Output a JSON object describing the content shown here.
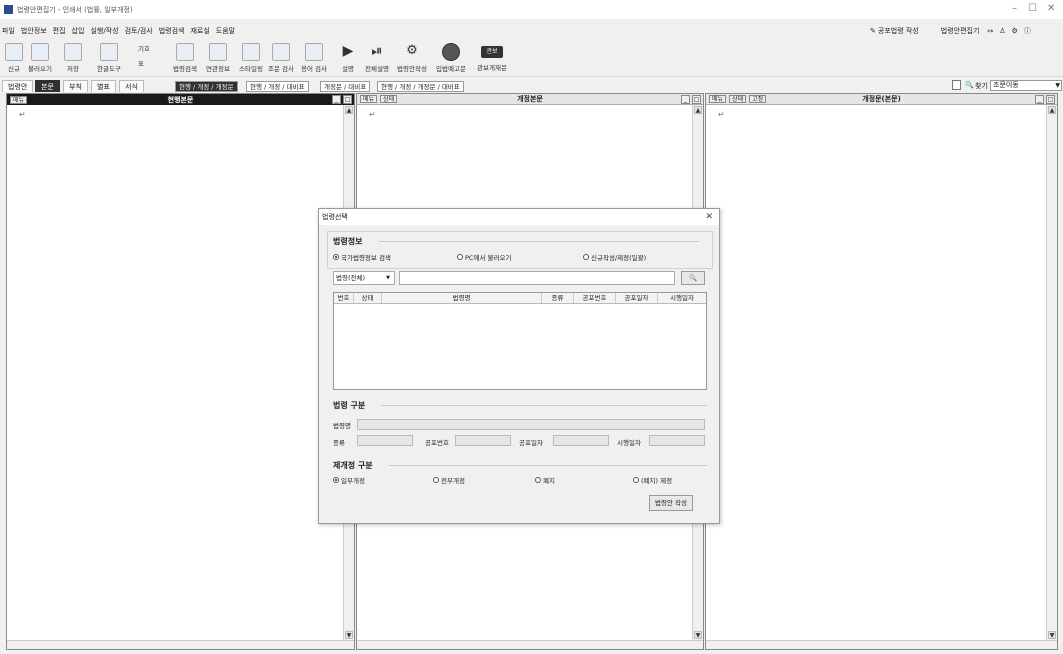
{
  "window": {
    "title": "법령안편집기 - 인쇄서 (법률, 일부개정)"
  },
  "menu": [
    "파일",
    "법안정보",
    "편집",
    "삽입",
    "실행/작성",
    "검토/검사",
    "법령검색",
    "재료실",
    "도움말"
  ],
  "menu_right": {
    "publish": "공포법령 작성",
    "editor": "법령안편집기"
  },
  "toolbar": {
    "new": "신규",
    "load": "불러오기",
    "save": "저장",
    "hangul": "한글도구",
    "symbol": "기호",
    "table": "표",
    "law_search": "법령검색",
    "related": "연관정보",
    "style": "스타일링",
    "clause_check": "조문 검사",
    "term_check": "용어 검사",
    "explain": "설명",
    "full_explain": "전체설명",
    "law_write": "법령안작성",
    "ip_notice": "입법예고문",
    "pub_notice": "관보게재문",
    "pub_notice_icon": "관보"
  },
  "tabs": {
    "items": [
      "법령안",
      "본문",
      "부칙",
      "별표",
      "서식"
    ],
    "views": [
      "현행 / 개정 / 개정문",
      "현행 / 개정 / 대비표",
      "개정문 / 대비표",
      "현행 / 개정 / 개정문 / 대비표"
    ]
  },
  "find": {
    "label": "찾기",
    "value": "조문이동"
  },
  "panels": {
    "current": {
      "menu": "메뉴",
      "title": "현행본문"
    },
    "amend": {
      "menu": "메뉴",
      "status": "상태",
      "title": "개정본문"
    },
    "amendtext": {
      "menu": "메뉴",
      "status": "상태",
      "fix": "고정",
      "title": "개정문(본문)"
    },
    "para_mark": "↵"
  },
  "dialog": {
    "title": "법령선택",
    "sec_info": "법령정보",
    "radio_info": [
      "국가법령정보 검색",
      "PC에서 불러오기",
      "신규작성/제정(일괄)"
    ],
    "filter": "법령(전체)",
    "search_value": "",
    "columns": [
      "번호",
      "상태",
      "법령명",
      "종류",
      "공포번호",
      "공포일자",
      "시행일자"
    ],
    "sec_kind": "법령 구분",
    "f_name": "법령명",
    "f_kind": "종류",
    "f_pubno": "공포번호",
    "f_pubdate": "공포일자",
    "f_effdate": "시행일자",
    "sec_amend": "제개정 구분",
    "radio_amend": [
      "일부개정",
      "전부개정",
      "폐지",
      "(폐지) 제정"
    ],
    "create_button": "법령안 작성"
  },
  "colors": {
    "dark": "#303030",
    "accent": "#2b4d8c"
  }
}
